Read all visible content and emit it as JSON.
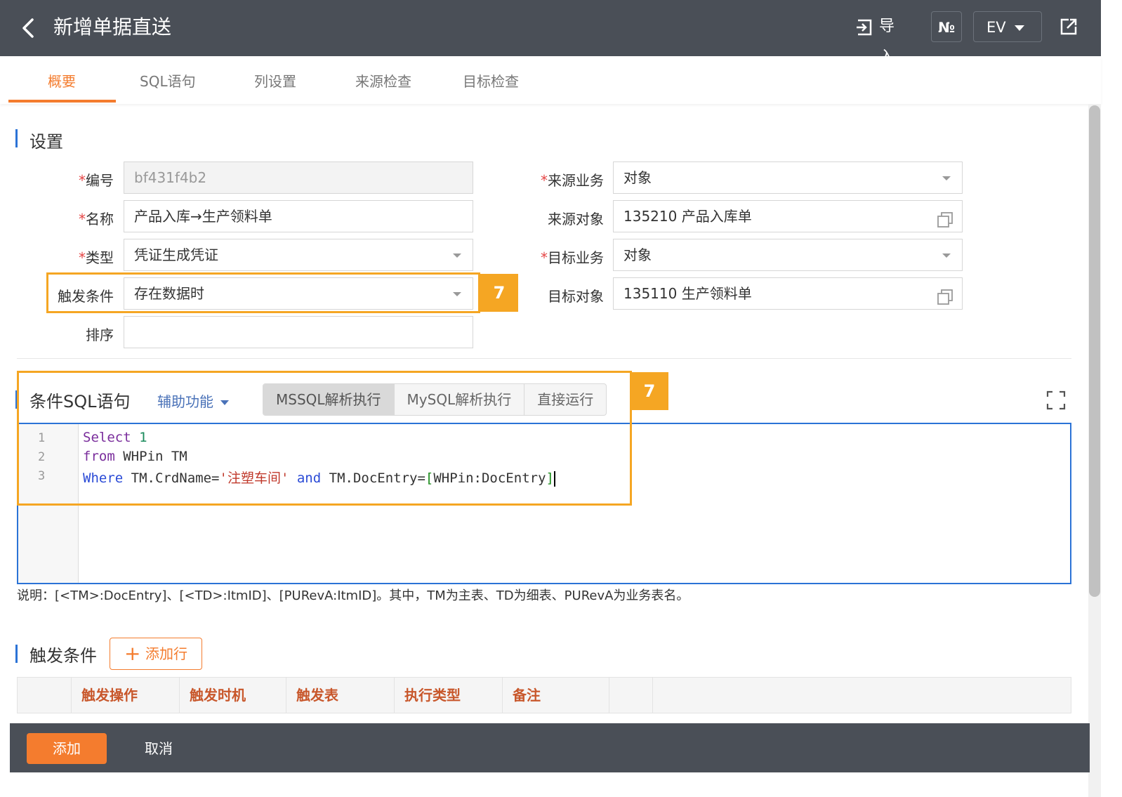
{
  "header": {
    "title": "新增单据直送",
    "import_label": "导入",
    "no_label": "№",
    "ev_label": "EV"
  },
  "tabs": [
    "概要",
    "SQL语句",
    "列设置",
    "来源检查",
    "目标检查"
  ],
  "settings": {
    "title": "设置",
    "code_label": "编号",
    "code_value": "bf431f4b2",
    "name_label": "名称",
    "name_value": "产品入库→生产领料单",
    "type_label": "类型",
    "type_value": "凭证生成凭证",
    "trigger_label": "触发条件",
    "trigger_value": "存在数据时",
    "order_label": "排序",
    "order_value": "",
    "source_biz_label": "来源业务",
    "source_biz_value": "对象",
    "source_obj_label": "来源对象",
    "source_obj_value": "135210 产品入库单",
    "target_biz_label": "目标业务",
    "target_biz_value": "对象",
    "target_obj_label": "目标对象",
    "target_obj_value": "135110 生产领料单"
  },
  "badges": {
    "first": "7",
    "second": "7"
  },
  "sql": {
    "title": "条件SQL语句",
    "assist_label": "辅助功能",
    "buttons": [
      "MSSQL解析执行",
      "MySQL解析执行",
      "直接运行"
    ],
    "line_numbers": [
      "1",
      "2",
      "3"
    ],
    "line1_kw": "Select",
    "line1_num": "1",
    "line2_kw": "from",
    "line2_rest": "WHPin TM",
    "line3_kw": "Where",
    "line3_a": "TM.CrdName=",
    "line3_str": "'注塑车间'",
    "line3_and": "and",
    "line3_b": "TM.DocEntry=",
    "line3_l": "[",
    "line3_ref": "WHPin:DocEntry",
    "line3_r": "]",
    "note": "说明：[<TM>:DocEntry]、[<TD>:ItmID]、[PURevA:ItmID]。其中，TM为主表、TD为细表、PURevA为业务表名。"
  },
  "triggers": {
    "title": "触发条件",
    "add_row_label": "添加行",
    "columns": [
      "触发操作",
      "触发时机",
      "触发表",
      "执行类型",
      "备注"
    ]
  },
  "footer": {
    "add_label": "添加",
    "cancel_label": "取消"
  },
  "colors": {
    "accent": "#f47c2e",
    "header_bg": "#4a4f57",
    "highlight": "#f5a623",
    "editor_border": "#2b73d6"
  }
}
